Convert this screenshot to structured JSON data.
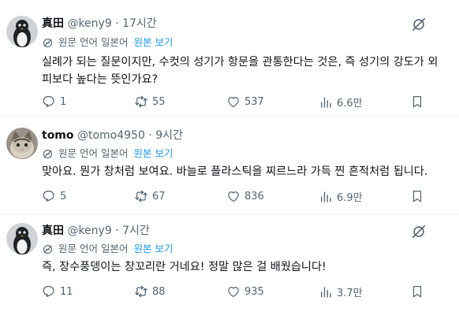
{
  "translate_label": "원문 언어 일본어",
  "translate_link": "원본 보기",
  "tweets": [
    {
      "name": "真田",
      "handle": "@keny9",
      "time": "17시간",
      "body_line1": "실례가 되는 질문이지만, 수컷의 성기가 항문을 관통한다는 것은, 즉 성기의 강도가 외",
      "body_line2": "피보다 높다는 뜻인가요?",
      "replies": "1",
      "reposts": "55",
      "likes": "537",
      "views": "6.6만",
      "avatar": "penguin-avatar"
    },
    {
      "name": "tomo",
      "handle": "@tomo4950",
      "time": "9시간",
      "body_line1": "맞아요. 뭔가 창처럼 보여요. 바늘로 플라스틱을 찌르느라 가득 찐 흔적처럼 됩니다.",
      "replies": "5",
      "reposts": "67",
      "likes": "836",
      "views": "6.9만",
      "avatar": "cat-avatar"
    },
    {
      "name": "真田",
      "handle": "@keny9",
      "time": "7시간",
      "body_line1": "즉, 장수풍뎅이는 창꼬리란 거네요! 정말 많은 걸 배웠습니다!",
      "replies": "11",
      "reposts": "88",
      "likes": "935",
      "views": "3.7만",
      "avatar": "penguin-avatar"
    }
  ],
  "dot": "·"
}
